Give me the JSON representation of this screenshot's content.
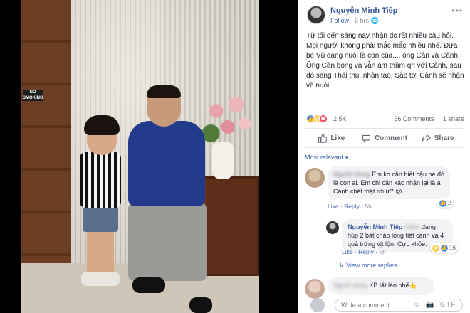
{
  "photo": {
    "sign_text": "NO SMOKING"
  },
  "post": {
    "author": "Nguyễn Minh Tiệp",
    "follow_label": "Follow",
    "time": "6 hrs",
    "more_icon": "more-dots-icon",
    "text": "Từ tối đến sáng nay nhận đc rất nhiều câu hỏi. Mọi người không phải thắc mắc nhiều nhé. Đứa bé Vũ đang nuôi là con của.... ông Cần và Cảnh. Ông Cần bóng và vẫn âm thầm qh với Cảnh, sau đó sang Thái thụ..nhân tạo. Sắp tới Cảnh sẽ nhận về nuôi.",
    "reaction_count": "2.5K",
    "comments_count": "66 Comments",
    "shares_count": "1 share",
    "actions": {
      "like": "Like",
      "comment": "Comment",
      "share": "Share"
    },
    "sort_label": "Most relevant ▾"
  },
  "comments": [
    {
      "name_hidden": "Người dùng",
      "text": "Em ko cần biết cậu bé đó là con ai. Em chỉ cần xác nhận lại là a Cảnh chết thật rồi ư? 😕",
      "like": "Like",
      "reply": "Reply",
      "time": "5h",
      "reaction_count": "2"
    },
    {
      "name": "Nguyễn Minh Tiệp",
      "text_blurred": "Cảnh",
      "text": "đang húp 2 bát cháo lòng tiết canh và 4 quả trứng vịt lộn. Cực khỏe.",
      "like": "Like",
      "reply": "Reply",
      "time": "5h",
      "reaction_count": "16"
    },
    {
      "text_blurred": "Người dùng",
      "text": "KB lắt léo nhể👆"
    }
  ],
  "view_more": "View more replies",
  "write_placeholder": "Write a comment...",
  "write_icons": "☺ 📷 GIF"
}
